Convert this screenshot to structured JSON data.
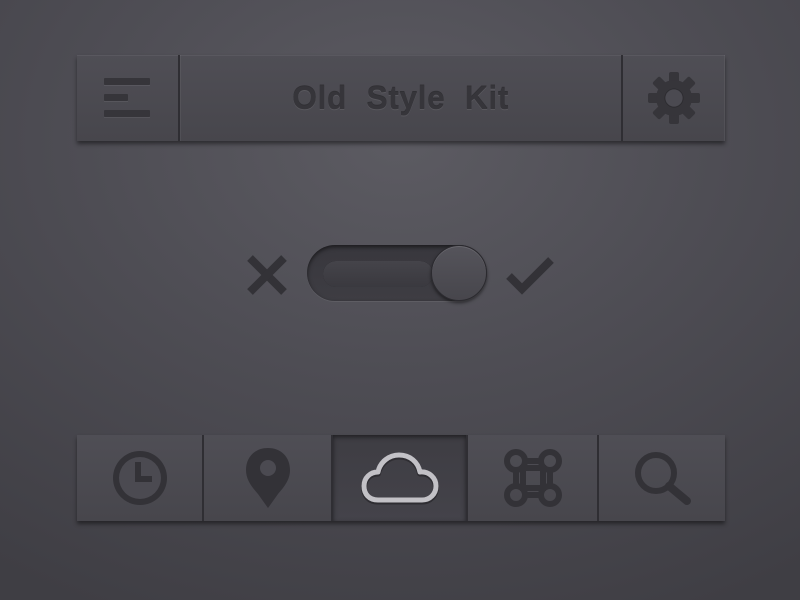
{
  "navbar": {
    "title": "Old Style Kit",
    "left_icon": "menu-icon",
    "right_icon": "gear-icon"
  },
  "toggle": {
    "off_icon": "close-icon",
    "on_icon": "check-icon",
    "state": "on",
    "level": 1.0
  },
  "tabbar": {
    "active_index": 2,
    "tabs": [
      {
        "icon": "clock-icon"
      },
      {
        "icon": "location-pin-icon"
      },
      {
        "icon": "cloud-icon"
      },
      {
        "icon": "command-icon"
      },
      {
        "icon": "search-icon"
      }
    ]
  },
  "colors": {
    "background": "#4e4d54",
    "bar": "#4b4a51",
    "engraved_icon": "#333237",
    "active_icon": "#c2c1c6",
    "divider": "#2f2e33"
  }
}
